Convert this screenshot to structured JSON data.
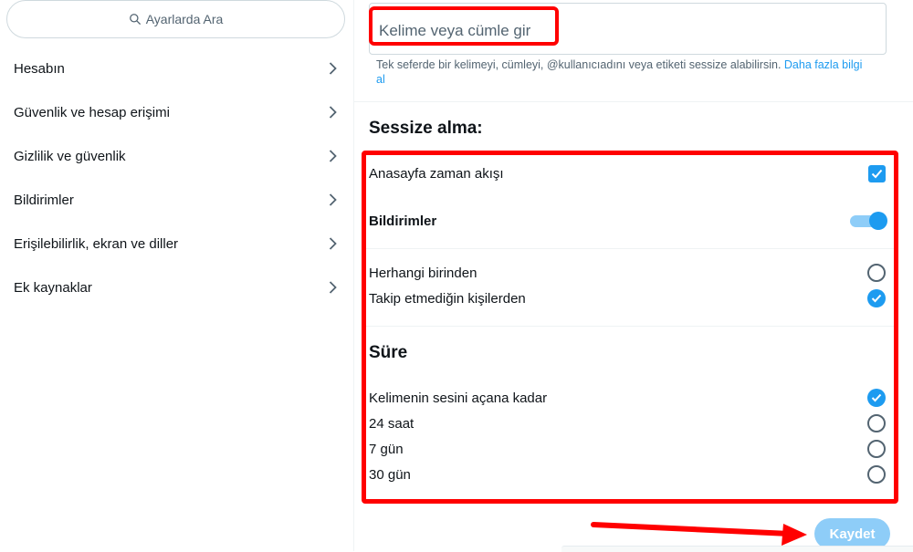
{
  "sidebar": {
    "search_placeholder": "Ayarlarda Ara",
    "items": [
      {
        "label": "Hesabın"
      },
      {
        "label": "Güvenlik ve hesap erişimi"
      },
      {
        "label": "Gizlilik ve güvenlik"
      },
      {
        "label": "Bildirimler"
      },
      {
        "label": "Erişilebilirlik, ekran ve diller"
      },
      {
        "label": "Ek kaynaklar"
      }
    ]
  },
  "mute_form": {
    "input_placeholder": "Kelime veya cümle gir",
    "input_value": "",
    "hint_text": "Tek seferde bir kelimeyi, cümleyi, @kullanıcıadını veya etiketi sessize alabilirsin.",
    "hint_link": "Daha fazla bilgi al",
    "section_mute_title": "Sessize alma:",
    "home_timeline_label": "Anasayfa zaman akışı",
    "home_timeline_checked": true,
    "notifications_label": "Bildirimler",
    "notifications_on": true,
    "from_anyone_label": "Herhangi birinden",
    "from_anyone_selected": false,
    "not_following_label": "Takip etmediğin kişilerden",
    "not_following_selected": true,
    "duration_title": "Süre",
    "durations": [
      {
        "label": "Kelimenin sesini açana kadar",
        "selected": true
      },
      {
        "label": "24 saat",
        "selected": false
      },
      {
        "label": "7 gün",
        "selected": false
      },
      {
        "label": "30 gün",
        "selected": false
      }
    ],
    "save_label": "Kaydet"
  },
  "colors": {
    "accent": "#1d9bf0",
    "annotation_red": "#ff0000",
    "disabled_button": "#8ecdf8"
  }
}
